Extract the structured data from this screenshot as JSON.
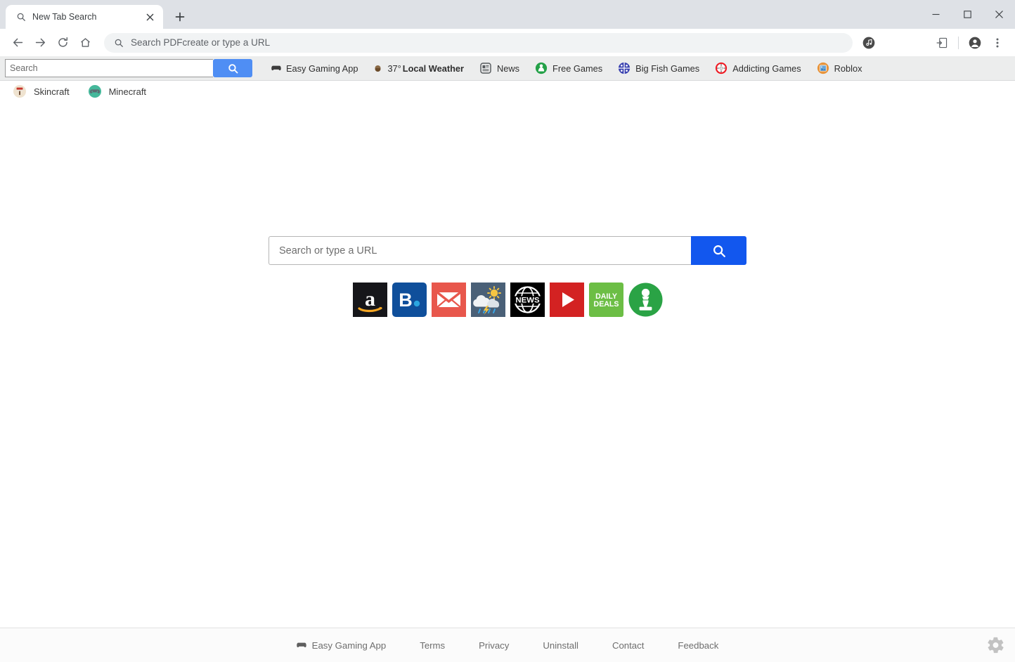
{
  "window": {
    "controls": {
      "minimize": "minimize-button",
      "maximize": "maximize-button",
      "close": "close-button"
    }
  },
  "tabstrip": {
    "tabs": [
      {
        "title": "New Tab Search",
        "favicon": "search-icon",
        "close_label": "×"
      }
    ],
    "new_tab_label": "+"
  },
  "toolbar": {
    "back_label": "←",
    "forward_label": "→",
    "reload_label": "⟳",
    "home_label": "⌂",
    "omnibox": {
      "value": "",
      "placeholder": "Search PDFcreate or type a URL",
      "icon": "search-icon"
    },
    "right_icons": [
      {
        "name": "music-note-icon"
      },
      {
        "name": "install-app-icon"
      },
      {
        "name": "profile-avatar-icon"
      },
      {
        "name": "three-dot-menu-icon"
      }
    ]
  },
  "extbar": {
    "search": {
      "value": "",
      "placeholder": "Search",
      "button_icon": "search-icon",
      "button_color": "#4f8ef4"
    },
    "links": [
      {
        "label": "Easy Gaming App",
        "icon": "gamepad-icon",
        "bold": ""
      },
      {
        "label": "37° ",
        "bold": "Local Weather",
        "icon": "weather-dot-icon"
      },
      {
        "label": "News",
        "icon": "news-paper-icon"
      },
      {
        "label": "Free Games",
        "icon": "green-person-icon"
      },
      {
        "label": "Big Fish Games",
        "icon": "bigfish-icon"
      },
      {
        "label": "Addicting Games",
        "icon": "addicting-icon"
      },
      {
        "label": "Roblox",
        "icon": "roblox-image-icon"
      }
    ]
  },
  "page_bookmarks": [
    {
      "label": "Skincraft",
      "icon": "skincraft-icon"
    },
    {
      "label": "Minecraft",
      "icon": "minecraft-gamepad-icon"
    }
  ],
  "main": {
    "search": {
      "value": "",
      "placeholder": "Search or type a URL",
      "button_icon": "search-icon",
      "button_color": "#1257ee"
    },
    "tiles": [
      {
        "name": "amazon",
        "title": "Amazon",
        "bg": "#16161a",
        "text": "a"
      },
      {
        "name": "booking",
        "title": "Booking.com",
        "bg": "#0f4f9b",
        "text": "B."
      },
      {
        "name": "email",
        "title": "Email",
        "bg": "#e8574c",
        "text": ""
      },
      {
        "name": "weather",
        "title": "Weather",
        "bg": "#4a6077",
        "text": ""
      },
      {
        "name": "news",
        "title": "News",
        "bg": "#000000",
        "text": "NEWS"
      },
      {
        "name": "video",
        "title": "Video",
        "bg": "#d32222",
        "text": ""
      },
      {
        "name": "daily-deals",
        "title": "Daily Deals",
        "bg": "#6cbe45",
        "text": "DAILY DEALS"
      },
      {
        "name": "games-pawn",
        "title": "Games",
        "bg": "#2aa345",
        "text": ""
      }
    ]
  },
  "footer": {
    "links": [
      {
        "label": "Easy Gaming App",
        "icon": "gamepad-icon"
      },
      {
        "label": "Terms",
        "icon": ""
      },
      {
        "label": "Privacy",
        "icon": ""
      },
      {
        "label": "Uninstall",
        "icon": ""
      },
      {
        "label": "Contact",
        "icon": ""
      },
      {
        "label": "Feedback",
        "icon": ""
      }
    ],
    "settings_icon": "gear-icon"
  }
}
